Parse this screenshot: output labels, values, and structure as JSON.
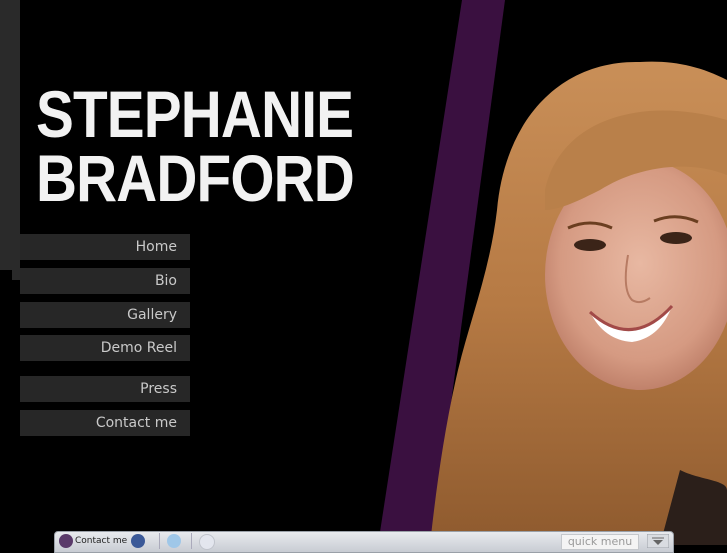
{
  "site": {
    "title_line1": "STEPHANIE",
    "title_line2": "BRADFORD"
  },
  "nav": [
    {
      "label": "Home"
    },
    {
      "label": "Bio"
    },
    {
      "label": "Gallery"
    },
    {
      "label": "Demo Reel"
    },
    {
      "label": "Press"
    },
    {
      "label": "Contact me"
    }
  ],
  "footer": {
    "contact_label": "Contact me",
    "quick_menu_placeholder": "quick menu"
  },
  "colors": {
    "background": "#000000",
    "accent_purple": "#3a1040",
    "nav_bg": "#272727",
    "nav_text": "#c9c9c9"
  },
  "icons": [
    "contact-icon",
    "facebook-icon",
    "twitter-icon",
    "flickr-icon",
    "dropdown-arrow-icon"
  ]
}
